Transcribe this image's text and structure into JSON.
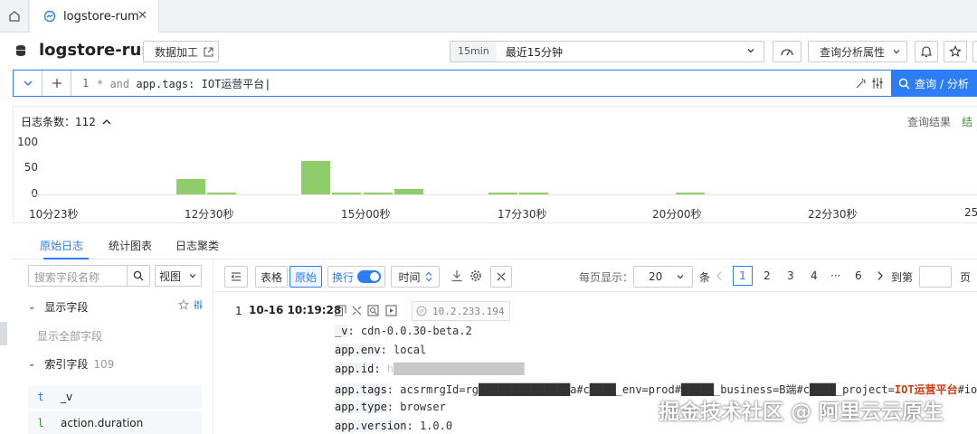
{
  "tabbar": {
    "active_tab": "logstore-rum",
    "close": "✕"
  },
  "header": {
    "title": "logstore-rum",
    "data_process_btn": "数据加工",
    "time_badge": "15min",
    "time_label": "最近15分钟",
    "analysis_attr_btn": "查询分析属性"
  },
  "query": {
    "line_number": "1",
    "prefix": "* and ",
    "field": "app.tags:",
    "value": " IOT运营平台",
    "search_btn": "查询 / 分析"
  },
  "histogram": {
    "count_label": "日志条数：",
    "count": "112",
    "right_tab_1": "查询结果",
    "right_tab_2": "结"
  },
  "chart_data": {
    "type": "bar",
    "y_ticks": [
      "100",
      "50",
      "0"
    ],
    "ylim": [
      0,
      100
    ],
    "x_ticks": [
      "10分23秒",
      "12分30秒",
      "15分00秒",
      "17分30秒",
      "20分00秒",
      "22分30秒",
      "25"
    ],
    "values": [
      0,
      0,
      0,
      30,
      4,
      0,
      0,
      64,
      3,
      3,
      10,
      0,
      0,
      3,
      3,
      0,
      0,
      0,
      0,
      3,
      0,
      0,
      0,
      0,
      0,
      0,
      0,
      0,
      0,
      0
    ],
    "color": "#8fcc6a"
  },
  "section_tabs": [
    "原始日志",
    "统计图表",
    "日志聚类"
  ],
  "fields_panel": {
    "search_placeholder": "搜索字段名称",
    "view_label": "视图",
    "display_group": "显示字段",
    "show_all": "显示全部字段",
    "index_group": "索引字段",
    "index_count": "109",
    "fields": [
      {
        "type": "t",
        "name": "_v"
      },
      {
        "type": "l",
        "name": "action.duration"
      }
    ]
  },
  "log_toolbar": {
    "table_btn": "表格",
    "raw_btn": "原始",
    "wrap_label": "换行",
    "time_label": "时间",
    "per_page_label": "每页显示：",
    "per_page_value": "20",
    "unit": "条",
    "pages": [
      "1",
      "2",
      "3",
      "4",
      "···",
      "6"
    ],
    "goto_label": "到第",
    "page_unit": "页"
  },
  "log_entry": {
    "index": "1",
    "time": "10-16 10:19:28",
    "ip": "10.2.233.194",
    "fields": [
      {
        "key": "_v",
        "value": "cdn-0.0.30-beta.2"
      },
      {
        "key": "app.env",
        "value": "local"
      },
      {
        "key": "app.id",
        "value": "h████████████████████"
      },
      {
        "key": "app.tags",
        "value": "acsrmrgId=rg██████████████a#c████_env=prod#█████_business=B端#c████_project=",
        "highlight": "IOT运营平台",
        "suffix": "#iot="
      },
      {
        "key": "app.type",
        "value": "browser"
      },
      {
        "key": "app.version",
        "value": "1.0.0"
      }
    ]
  },
  "watermark": "掘金技术社区 @ 阿里云云原生"
}
